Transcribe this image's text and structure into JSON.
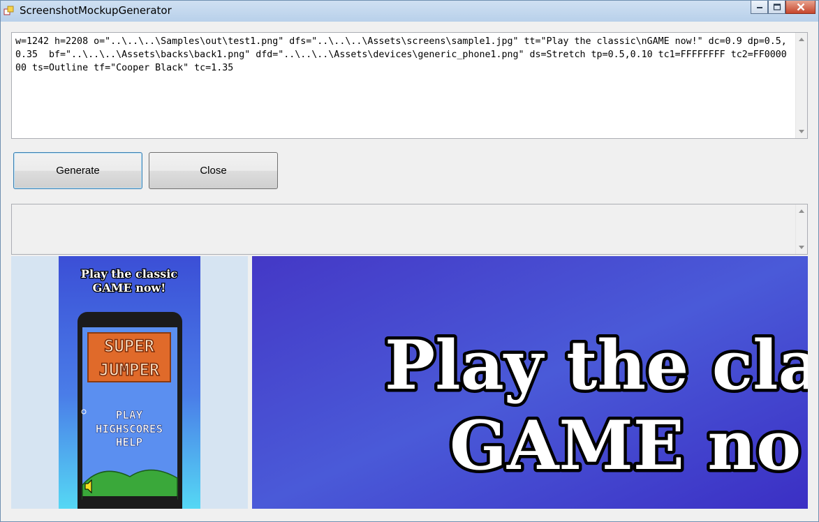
{
  "window": {
    "title": "ScreenshotMockupGenerator"
  },
  "command": {
    "text": "w=1242 h=2208 o=\"..\\..\\..\\Samples\\out\\test1.png\" dfs=\"..\\..\\..\\Assets\\screens\\sample1.jpg\" tt=\"Play the classic\\nGAME now!\" dc=0.9 dp=0.5,0.35  bf=\"..\\..\\..\\Assets\\backs\\back1.png\" dfd=\"..\\..\\..\\Assets\\devices\\generic_phone1.png\" ds=Stretch tp=0.5,0.10 tc1=FFFFFFFF tc2=FF000000 ts=Outline tf=\"Cooper Black\" tc=1.35"
  },
  "buttons": {
    "generate": "Generate",
    "close": "Close"
  },
  "log": {
    "text": ""
  },
  "preview_small": {
    "title_line1": "Play the classic",
    "title_line2": "GAME now!",
    "game_logo_line1": "SUPER",
    "game_logo_line2": "JUMPER",
    "menu": [
      "PLAY",
      "HIGHSCORES",
      "HELP"
    ]
  },
  "preview_large": {
    "title_line1": "Play the cla",
    "title_line2": "GAME no"
  },
  "colors": {
    "accent_focus": "#3c7fb1",
    "background_blue": "#4a45d0",
    "phone_screen": "#5b8ff0",
    "logo_orange": "#e06a2a"
  }
}
